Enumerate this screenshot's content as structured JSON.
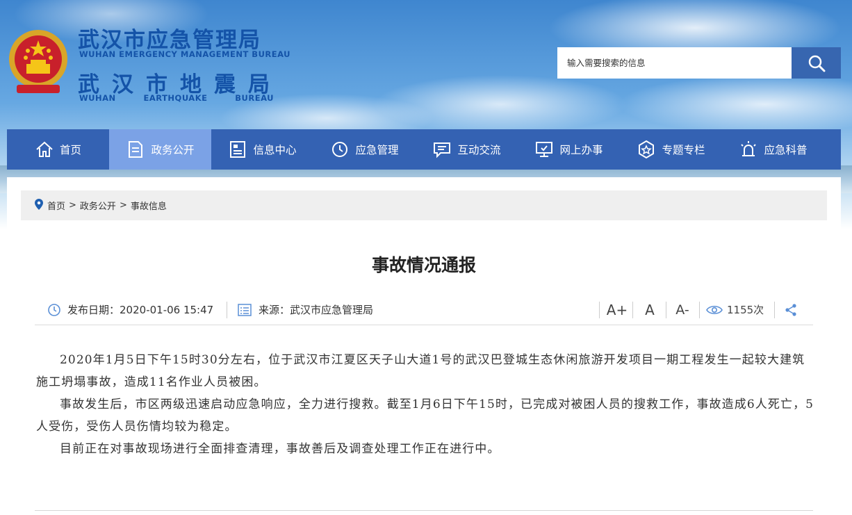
{
  "site": {
    "name_1": "武汉市应急管理局",
    "name_1_en": "WUHAN EMERGENCY MANAGEMENT BUREAU",
    "name_2": "武汉市地震局",
    "name_2_en": [
      "WUHAN",
      "EARTHQUAKE",
      "BUREAU"
    ]
  },
  "search": {
    "placeholder": "输入需要搜索的信息"
  },
  "nav": {
    "items": [
      {
        "label": "首页",
        "icon": "home-icon"
      },
      {
        "label": "政务公开",
        "icon": "document-icon",
        "active": true
      },
      {
        "label": "信息中心",
        "icon": "news-icon"
      },
      {
        "label": "应急管理",
        "icon": "clock-icon"
      },
      {
        "label": "互动交流",
        "icon": "chat-icon"
      },
      {
        "label": "网上办事",
        "icon": "monitor-icon"
      },
      {
        "label": "专题专栏",
        "icon": "star-badge-icon"
      },
      {
        "label": "应急科普",
        "icon": "alarm-light-icon"
      }
    ]
  },
  "breadcrumb": {
    "items": [
      "首页",
      "政务公开",
      "事故信息"
    ],
    "separator": ">"
  },
  "article": {
    "title": "事故情况通报",
    "date_label": "发布日期：",
    "date": "2020-01-06 15:47",
    "source_label": "来源：",
    "source": "武汉市应急管理局",
    "font_larger": "A+",
    "font_normal": "A",
    "font_smaller": "A-",
    "views": "1155次",
    "paragraphs": [
      "2020年1月5日下午15时30分左右，位于武汉市江夏区天子山大道1号的武汉巴登城生态休闲旅游开发项目一期工程发生一起较大建筑施工坍塌事故，造成11名作业人员被困。",
      "事故发生后，市区两级迅速启动应急响应，全力进行搜救。截至1月6日下午15时，已完成对被困人员的搜救工作，事故造成6人死亡，5人受伤，受伤人员伤情均较为稳定。",
      "目前正在对事故现场进行全面排查清理，事故善后及调查处理工作正在进行中。"
    ]
  },
  "colors": {
    "nav_bg": "#3462b3",
    "nav_active": "#7ba2e6",
    "brand": "#1453a8",
    "search_btn": "#3766b0"
  }
}
